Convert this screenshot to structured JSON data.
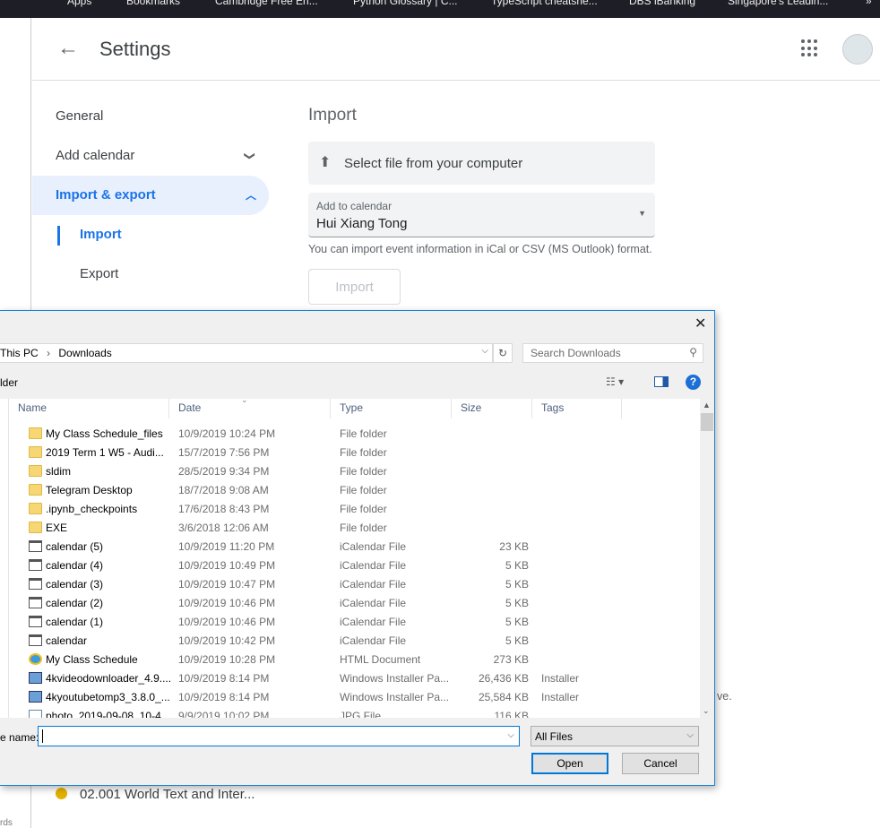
{
  "bookmarks": [
    "Apps",
    "Bookmarks",
    "Cambridge Free En...",
    "Python Glossary | C...",
    "TypeScript cheatshe...",
    "DBS iBanking",
    "Singapore's Leadin...",
    "»"
  ],
  "left_strip_footer": "rds",
  "header": {
    "title": "Settings",
    "back_icon": "arrow-back-icon",
    "apps_icon": "grid-apps-icon"
  },
  "nav": {
    "items": [
      {
        "label": "General"
      },
      {
        "label": "Add calendar",
        "chevron": "chevron-down-icon"
      },
      {
        "label": "Import & export",
        "chevron": "chevron-up-icon",
        "active": true
      },
      {
        "label": "Import",
        "selected": true
      },
      {
        "label": "Export"
      }
    ]
  },
  "import": {
    "heading": "Import",
    "select_file": "Select file from your computer",
    "add_to_calendar_label": "Add to calendar",
    "add_to_calendar_value": "Hui Xiang Tong",
    "hint": "You can import event information in iCal or CSV (MS Outlook) format.",
    "import_button": "Import"
  },
  "background_text": "ve.",
  "calendar_item": {
    "label": "02.001 World Text and Inter...",
    "color": "#e4b100"
  },
  "dialog": {
    "close": "✕",
    "address": [
      "This PC",
      "Downloads"
    ],
    "search_placeholder": "Search Downloads",
    "toolbar_left": "lder",
    "columns": [
      "Name",
      "Date",
      "Type",
      "Size",
      "Tags"
    ],
    "files": [
      {
        "name": "My Class Schedule_files",
        "date": "10/9/2019 10:24 PM",
        "type": "File folder",
        "size": "",
        "tags": "",
        "icon": "folder"
      },
      {
        "name": "2019 Term 1 W5 - Audi...",
        "date": "15/7/2019 7:56 PM",
        "type": "File folder",
        "size": "",
        "tags": "",
        "icon": "folder"
      },
      {
        "name": "sldim",
        "date": "28/5/2019 9:34 PM",
        "type": "File folder",
        "size": "",
        "tags": "",
        "icon": "folder"
      },
      {
        "name": "Telegram Desktop",
        "date": "18/7/2018 9:08 AM",
        "type": "File folder",
        "size": "",
        "tags": "",
        "icon": "folder"
      },
      {
        "name": ".ipynb_checkpoints",
        "date": "17/6/2018 8:43 PM",
        "type": "File folder",
        "size": "",
        "tags": "",
        "icon": "folder"
      },
      {
        "name": "EXE",
        "date": "3/6/2018 12:06 AM",
        "type": "File folder",
        "size": "",
        "tags": "",
        "icon": "folder"
      },
      {
        "name": "calendar (5)",
        "date": "10/9/2019 11:20 PM",
        "type": "iCalendar File",
        "size": "23 KB",
        "tags": "",
        "icon": "ical"
      },
      {
        "name": "calendar (4)",
        "date": "10/9/2019 10:49 PM",
        "type": "iCalendar File",
        "size": "5 KB",
        "tags": "",
        "icon": "ical"
      },
      {
        "name": "calendar (3)",
        "date": "10/9/2019 10:47 PM",
        "type": "iCalendar File",
        "size": "5 KB",
        "tags": "",
        "icon": "ical"
      },
      {
        "name": "calendar (2)",
        "date": "10/9/2019 10:46 PM",
        "type": "iCalendar File",
        "size": "5 KB",
        "tags": "",
        "icon": "ical"
      },
      {
        "name": "calendar (1)",
        "date": "10/9/2019 10:46 PM",
        "type": "iCalendar File",
        "size": "5 KB",
        "tags": "",
        "icon": "ical"
      },
      {
        "name": "calendar",
        "date": "10/9/2019 10:42 PM",
        "type": "iCalendar File",
        "size": "5 KB",
        "tags": "",
        "icon": "ical"
      },
      {
        "name": "My Class Schedule",
        "date": "10/9/2019 10:28 PM",
        "type": "HTML Document",
        "size": "273 KB",
        "tags": "",
        "icon": "html"
      },
      {
        "name": "4kvideodownloader_4.9....",
        "date": "10/9/2019 8:14 PM",
        "type": "Windows Installer Pa...",
        "size": "26,436 KB",
        "tags": "Installer",
        "icon": "msi"
      },
      {
        "name": "4kyoutubetomp3_3.8.0_...",
        "date": "10/9/2019 8:14 PM",
        "type": "Windows Installer Pa...",
        "size": "25,584 KB",
        "tags": "Installer",
        "icon": "msi"
      },
      {
        "name": "photo_2019-09-08_10-4...",
        "date": "9/9/2019 10:02 PM",
        "type": "JPG File",
        "size": "116 KB",
        "tags": "",
        "icon": "jpg"
      }
    ],
    "file_name_label": "e name:",
    "file_name_value": "",
    "file_type": "All Files",
    "open": "Open",
    "cancel": "Cancel"
  }
}
